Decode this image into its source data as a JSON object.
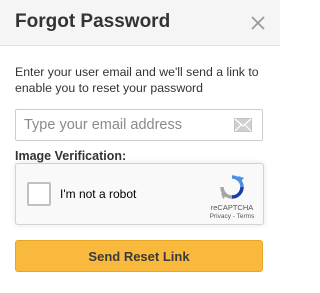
{
  "dialog": {
    "title": "Forgot Password",
    "close_icon": "close-icon"
  },
  "description": "Enter your user email and we'll send a link to enable you to reset your password",
  "email": {
    "value": "",
    "placeholder": "Type your email address",
    "icon": "envelope-icon"
  },
  "verification": {
    "label": "Image Verification:",
    "recaptcha": {
      "checkbox_label": "I'm not a robot",
      "checked": false,
      "brand": "reCAPTCHA",
      "privacy_label": "Privacy",
      "separator": " - ",
      "terms_label": "Terms",
      "logo_icon": "recaptcha-logo-icon"
    }
  },
  "submit_label": "Send Reset Link",
  "colors": {
    "header_bg": "#f5f5f5",
    "button_bg": "#f8b93c",
    "text": "#333333",
    "recaptcha_blue": "#1c3aa9"
  }
}
